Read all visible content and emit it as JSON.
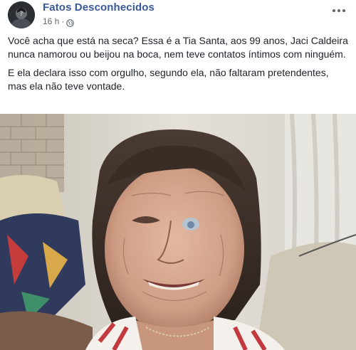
{
  "post": {
    "author": "Fatos Desconhecidos",
    "timestamp": "16 h",
    "separator": "·",
    "paragraphs": [
      "Você acha que está na seca? Essa é a Tia Santa, aos 99 anos, Jaci Caldeira nunca namorou ou beijou na boca, nem teve contatos íntimos com ninguém.",
      "E ela declara isso com orgulho, segundo ela, não faltaram pretendentes, mas ela não teve vontade."
    ]
  },
  "icons": {
    "audience": "globe-icon",
    "menu": "more-options-icon"
  },
  "colors": {
    "author_link": "#385898",
    "text": "#1d2129",
    "meta": "#616770"
  }
}
